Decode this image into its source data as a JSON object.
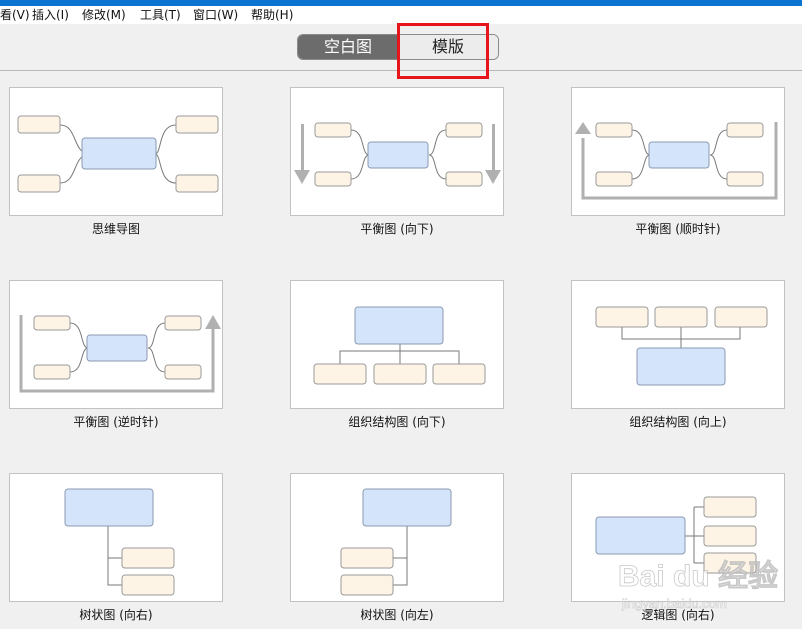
{
  "menu": [
    "看(V)",
    "插入(I)",
    "修改(M)",
    "工具(T)",
    "窗口(W)",
    "帮助(H)"
  ],
  "toolbar": {
    "blank_label": "空白图",
    "template_label": "模版"
  },
  "templates": [
    {
      "caption": "思维导图",
      "icon": "mind-map-icon"
    },
    {
      "caption": "平衡图 (向下)",
      "icon": "balance-down-icon"
    },
    {
      "caption": "平衡图 (顺时针)",
      "icon": "balance-clockwise-icon"
    },
    {
      "caption": "平衡图 (逆时针)",
      "icon": "balance-counterclockwise-icon"
    },
    {
      "caption": "组织结构图 (向下)",
      "icon": "org-chart-down-icon"
    },
    {
      "caption": "组织结构图 (向上)",
      "icon": "org-chart-up-icon"
    },
    {
      "caption": "树状图 (向右)",
      "icon": "tree-right-icon"
    },
    {
      "caption": "树状图 (向左)",
      "icon": "tree-left-icon"
    },
    {
      "caption": "逻辑图 (向右)",
      "icon": "logic-right-icon"
    }
  ],
  "watermark": {
    "brand": "Bai du 经验",
    "url": "jingyan.baidu.com"
  },
  "colors": {
    "accent_blue": "#0b74d1",
    "topic_fill": "#d4e4fb",
    "subtopic_fill": "#fdf4e6",
    "highlight_red": "#e8141c",
    "selected_segment": "#6c6c6c"
  }
}
